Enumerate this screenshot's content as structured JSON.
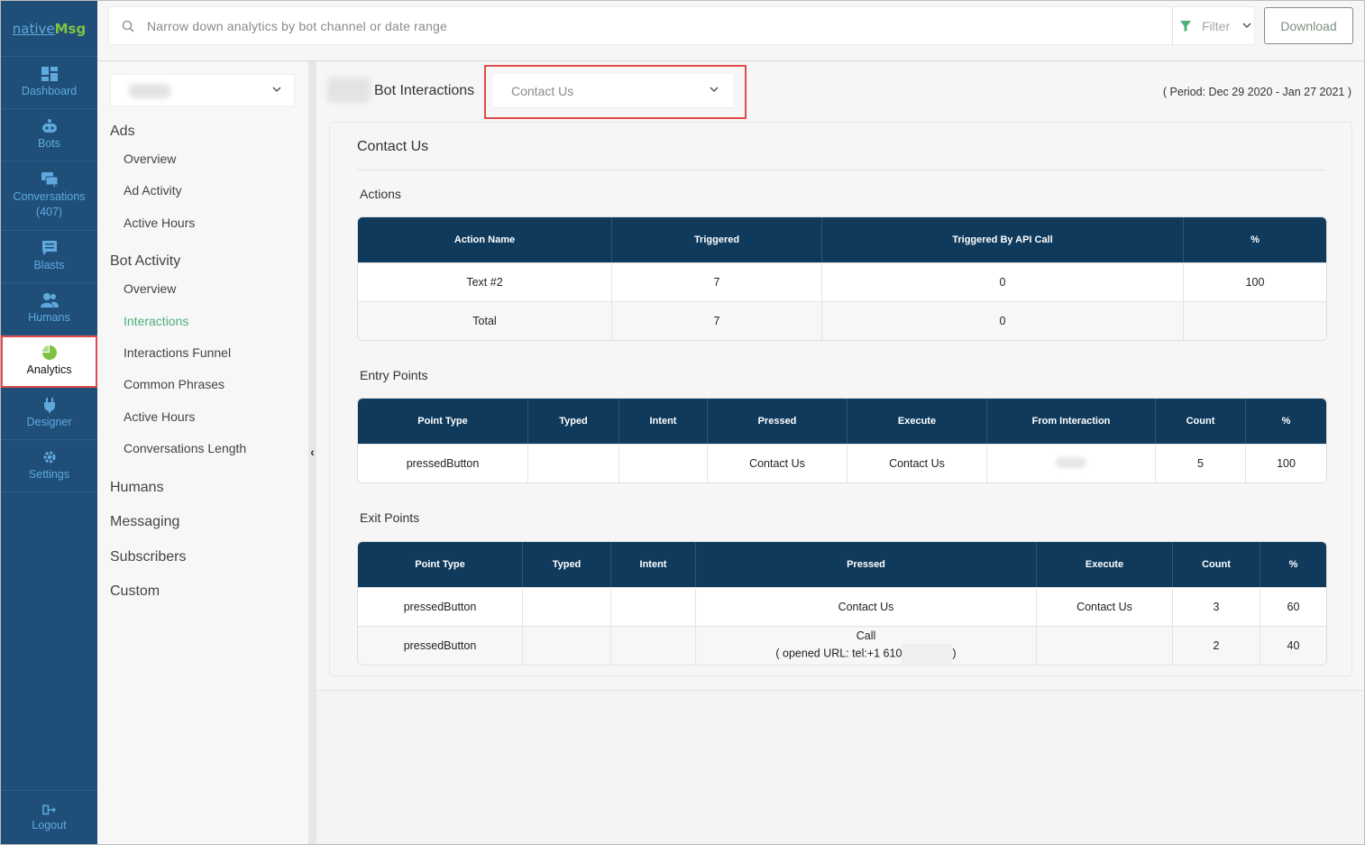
{
  "brand": {
    "logo_part1": "native",
    "logo_part2": "Msg"
  },
  "sidebar": {
    "items": [
      {
        "label": "Dashboard",
        "icon": "dashboard-icon"
      },
      {
        "label": "Bots",
        "icon": "bot-icon"
      },
      {
        "label": "Conversations",
        "count": "(407)",
        "icon": "chat-icon"
      },
      {
        "label": "Blasts",
        "icon": "message-icon"
      },
      {
        "label": "Humans",
        "icon": "users-icon"
      },
      {
        "label": "Analytics",
        "icon": "pie-chart-icon"
      },
      {
        "label": "Designer",
        "icon": "plug-icon"
      },
      {
        "label": "Settings",
        "icon": "gear-icon"
      }
    ],
    "logout": "Logout",
    "colors": {
      "bg": "#1f4f78",
      "text": "#5fa9dd",
      "active_icon": "#7fc241"
    }
  },
  "topbar": {
    "search_placeholder": "Narrow down analytics by bot channel or date range",
    "filter_label": "Filter",
    "download_label": "Download"
  },
  "submenu": {
    "sections": [
      {
        "title": "Ads",
        "items": [
          "Overview",
          "Ad Activity",
          "Active Hours"
        ]
      },
      {
        "title": "Bot Activity",
        "items": [
          "Overview",
          "Interactions",
          "Interactions Funnel",
          "Common Phrases",
          "Active Hours",
          "Conversations Length"
        ]
      }
    ],
    "active_item": "Interactions",
    "other_sections": [
      "Humans",
      "Messaging",
      "Subscribers",
      "Custom"
    ]
  },
  "main": {
    "title": "Bot Interactions",
    "selected_interaction": "Contact Us",
    "period": "( Period: Dec 29 2020 - Jan 27 2021 )",
    "card_title": "Contact Us",
    "actions": {
      "title": "Actions",
      "headers": [
        "Action Name",
        "Triggered",
        "Triggered By API Call",
        "%"
      ],
      "rows": [
        [
          "Text #2",
          "7",
          "0",
          "100"
        ],
        [
          "Total",
          "7",
          "0",
          ""
        ]
      ]
    },
    "entry_points": {
      "title": "Entry Points",
      "headers": [
        "Point Type",
        "Typed",
        "Intent",
        "Pressed",
        "Execute",
        "From Interaction",
        "Count",
        "%"
      ],
      "rows": [
        [
          "pressedButton",
          "",
          "",
          "Contact Us",
          "Contact Us",
          "",
          "5",
          "100"
        ]
      ]
    },
    "exit_points": {
      "title": "Exit Points",
      "headers": [
        "Point Type",
        "Typed",
        "Intent",
        "Pressed",
        "Execute",
        "Count",
        "%"
      ],
      "rows": [
        [
          "pressedButton",
          "",
          "",
          "Contact Us",
          "Contact Us",
          "3",
          "60"
        ],
        [
          "pressedButton",
          "",
          "",
          "Call",
          "",
          "2",
          "40"
        ]
      ],
      "row2_pressed_detail_prefix": "( opened URL: tel:+1 610",
      "row2_pressed_detail_suffix": ")"
    }
  }
}
